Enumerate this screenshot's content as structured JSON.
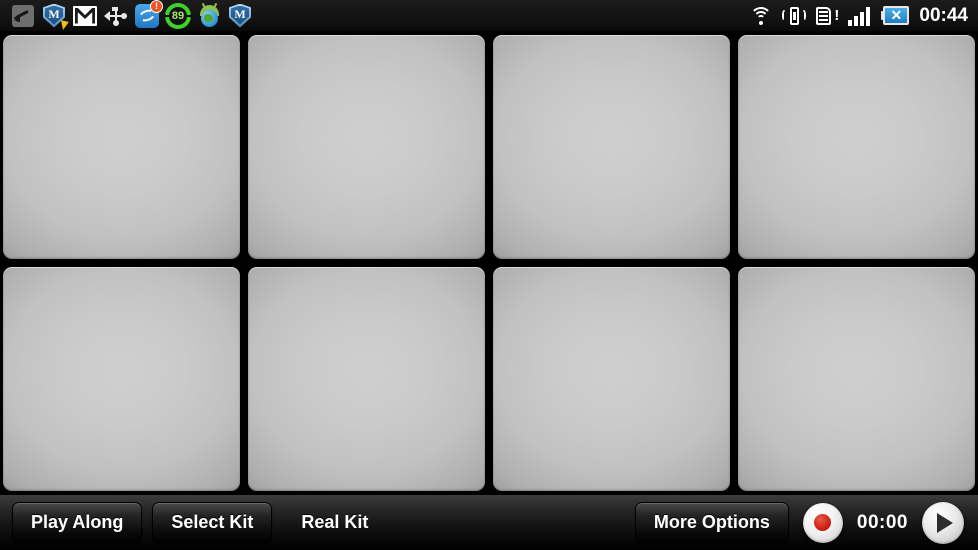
{
  "status_bar": {
    "left_icons": [
      {
        "name": "stylus-icon",
        "label": "Stylus"
      },
      {
        "name": "security-shield-icon",
        "label": "M"
      },
      {
        "name": "gmail-icon",
        "label": "M"
      },
      {
        "name": "usb-icon",
        "label": "USB"
      },
      {
        "name": "sync-app-icon",
        "label": "!"
      },
      {
        "name": "battery-percent-icon",
        "label": "89"
      },
      {
        "name": "android-browser-icon",
        "label": "Browser"
      },
      {
        "name": "mcafee-shield-icon",
        "label": "M"
      }
    ],
    "sync_badge": "!",
    "battery_percent": "89",
    "right_icons": [
      {
        "name": "wifi-icon",
        "label": "Wi-Fi"
      },
      {
        "name": "vibrate-icon",
        "label": "Vibrate"
      },
      {
        "name": "sim-alert-icon",
        "label": "!"
      },
      {
        "name": "signal-bars-icon",
        "label": "Signal"
      },
      {
        "name": "battery-disconnected-icon",
        "label": "✕"
      }
    ],
    "sim_alert": "!",
    "battery_x": "✕",
    "time": "00:44"
  },
  "pads": [
    {
      "id": "pad-1",
      "label": ""
    },
    {
      "id": "pad-2",
      "label": ""
    },
    {
      "id": "pad-3",
      "label": ""
    },
    {
      "id": "pad-4",
      "label": ""
    },
    {
      "id": "pad-5",
      "label": ""
    },
    {
      "id": "pad-6",
      "label": ""
    },
    {
      "id": "pad-7",
      "label": ""
    },
    {
      "id": "pad-8",
      "label": ""
    }
  ],
  "toolbar": {
    "play_along_label": "Play Along",
    "select_kit_label": "Select Kit",
    "real_kit_label": "Real Kit",
    "more_options_label": "More Options",
    "timer": "00:00",
    "record_icon": "record-icon",
    "play_icon": "play-icon"
  },
  "colors": {
    "background": "#000000",
    "pad_face": "#c4c4c4",
    "pad_edge": "#9d9d9d",
    "bar_top": "#3c3c3c",
    "record_red": "#cf2418",
    "battery_green": "#3fd02a",
    "accent_blue": "#2277c4"
  }
}
